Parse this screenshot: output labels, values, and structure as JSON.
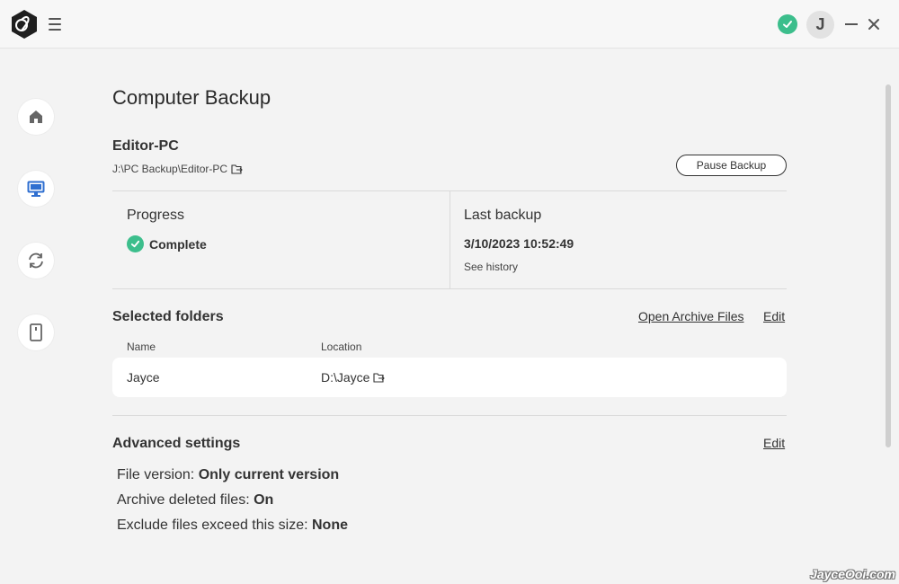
{
  "page": {
    "title": "Computer Backup"
  },
  "device": {
    "name": "Editor-PC",
    "path": "J:\\PC Backup\\Editor-PC",
    "pause_label": "Pause Backup"
  },
  "status": {
    "progress_label": "Progress",
    "progress_value": "Complete",
    "last_backup_label": "Last backup",
    "last_backup_time": "3/10/2023 10:52:49",
    "see_history": "See history"
  },
  "selected_folders": {
    "title": "Selected folders",
    "open_archive": "Open Archive Files",
    "edit": "Edit",
    "columns": [
      "Name",
      "Location"
    ],
    "rows": [
      {
        "name": "Jayce",
        "location": "D:\\Jayce"
      }
    ]
  },
  "advanced": {
    "title": "Advanced settings",
    "edit": "Edit",
    "settings": [
      {
        "label": "File version: ",
        "value": "Only current version"
      },
      {
        "label": "Archive deleted files: ",
        "value": "On"
      },
      {
        "label": "Exclude files exceed this size: ",
        "value": "None"
      }
    ]
  },
  "header": {
    "avatar_initial": "J"
  },
  "sidebar": {
    "items": [
      {
        "icon": "home-icon"
      },
      {
        "icon": "computer-icon"
      },
      {
        "icon": "sync-icon"
      },
      {
        "icon": "device-icon"
      }
    ]
  },
  "colors": {
    "accent": "#2f6fd0",
    "success": "#3cbe8c"
  },
  "watermark": "JayceOoi.com"
}
